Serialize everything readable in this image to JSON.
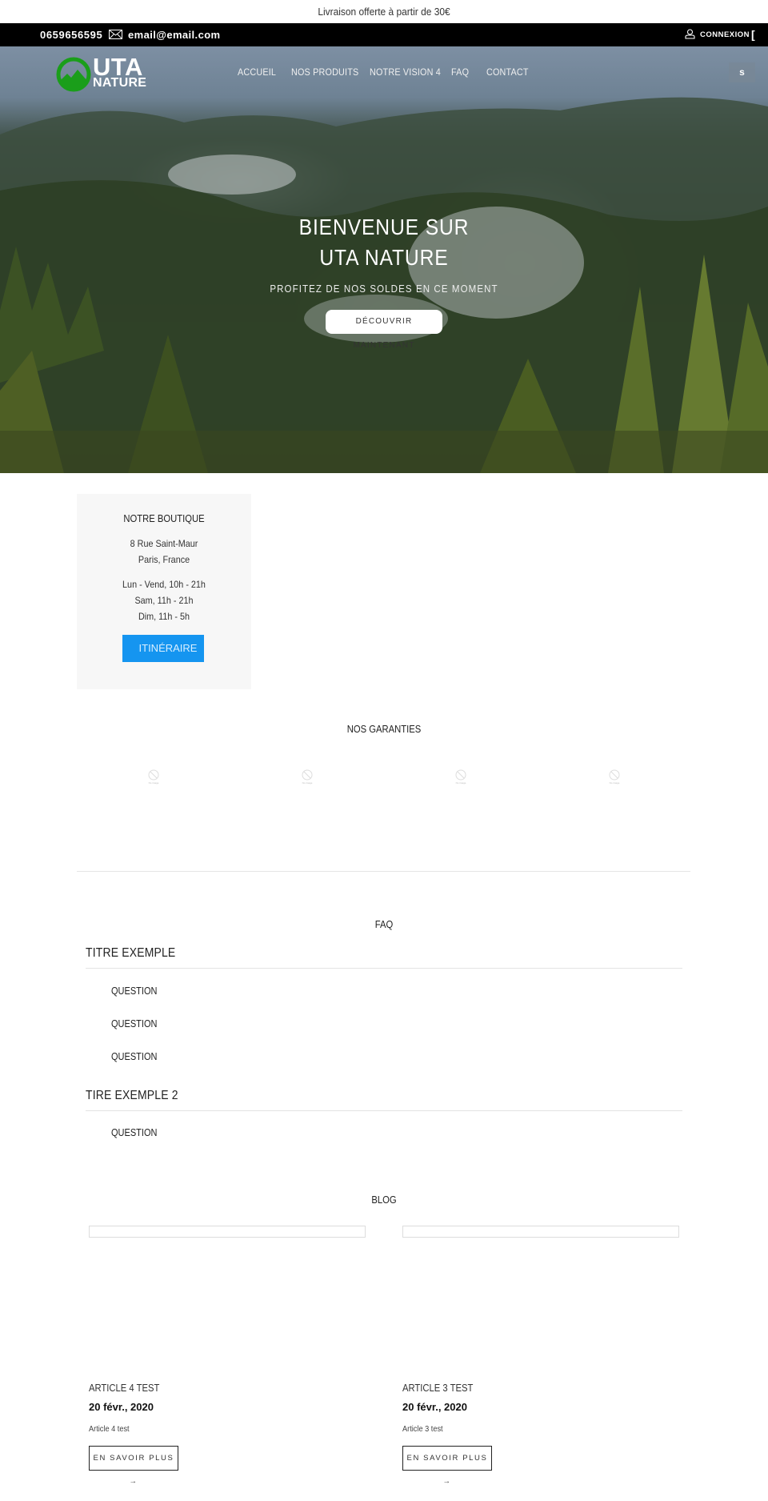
{
  "announcement": "Livraison offerte à partir de 30€",
  "topbar": {
    "phone": "0659656595",
    "email": "email@email.com",
    "login_label": "CONNEXION",
    "bracket": "["
  },
  "brand": {
    "name_line1": "UTA",
    "name_line2": "NATURE",
    "logo_color": "#1a9e1a"
  },
  "nav": {
    "items": [
      {
        "label": "ACCUEIL"
      },
      {
        "label": "NOS PRODUITS"
      },
      {
        "label": "NOTRE VISION 4"
      },
      {
        "label": "FAQ"
      },
      {
        "label": "CONTACT"
      }
    ],
    "search_label": "s"
  },
  "hero": {
    "title": "BIENVENUE SUR UTA NATURE",
    "subtitle": "PROFITEZ DE NOS SOLDES EN CE MOMENT",
    "cta_label": "DÉCOUVRIR MAINTENANT"
  },
  "shop": {
    "title": "NOTRE BOUTIQUE",
    "address_line1": "8 Rue Saint-Maur",
    "address_line2": "Paris, France",
    "hours": [
      "Lun - Vend, 10h - 21h",
      "Sam, 11h - 21h",
      "Dim, 11h - 5h"
    ],
    "button_label": "ITINÉRAIRE",
    "button_color": "#1595f0"
  },
  "guarantees": {
    "title": "NOS GARANTIES",
    "items": [
      {
        "caption": "No image"
      },
      {
        "caption": "No image"
      },
      {
        "caption": "No image"
      },
      {
        "caption": "No image"
      }
    ]
  },
  "faq": {
    "title": "FAQ",
    "groups": [
      {
        "heading": "TITRE EXEMPLE",
        "questions": [
          "QUESTION",
          "QUESTION",
          "QUESTION"
        ]
      },
      {
        "heading": "TIRE EXEMPLE 2",
        "questions": [
          "QUESTION"
        ]
      }
    ]
  },
  "blog": {
    "title": "BLOG",
    "articles": [
      {
        "title": "ARTICLE 4 TEST",
        "date": "20 févr., 2020",
        "excerpt": "Article 4 test",
        "more_label": "EN SAVOIR PLUS →"
      },
      {
        "title": "ARTICLE 3 TEST",
        "date": "20 févr., 2020",
        "excerpt": "Article 3 test",
        "more_label": "EN SAVOIR PLUS →"
      }
    ]
  }
}
